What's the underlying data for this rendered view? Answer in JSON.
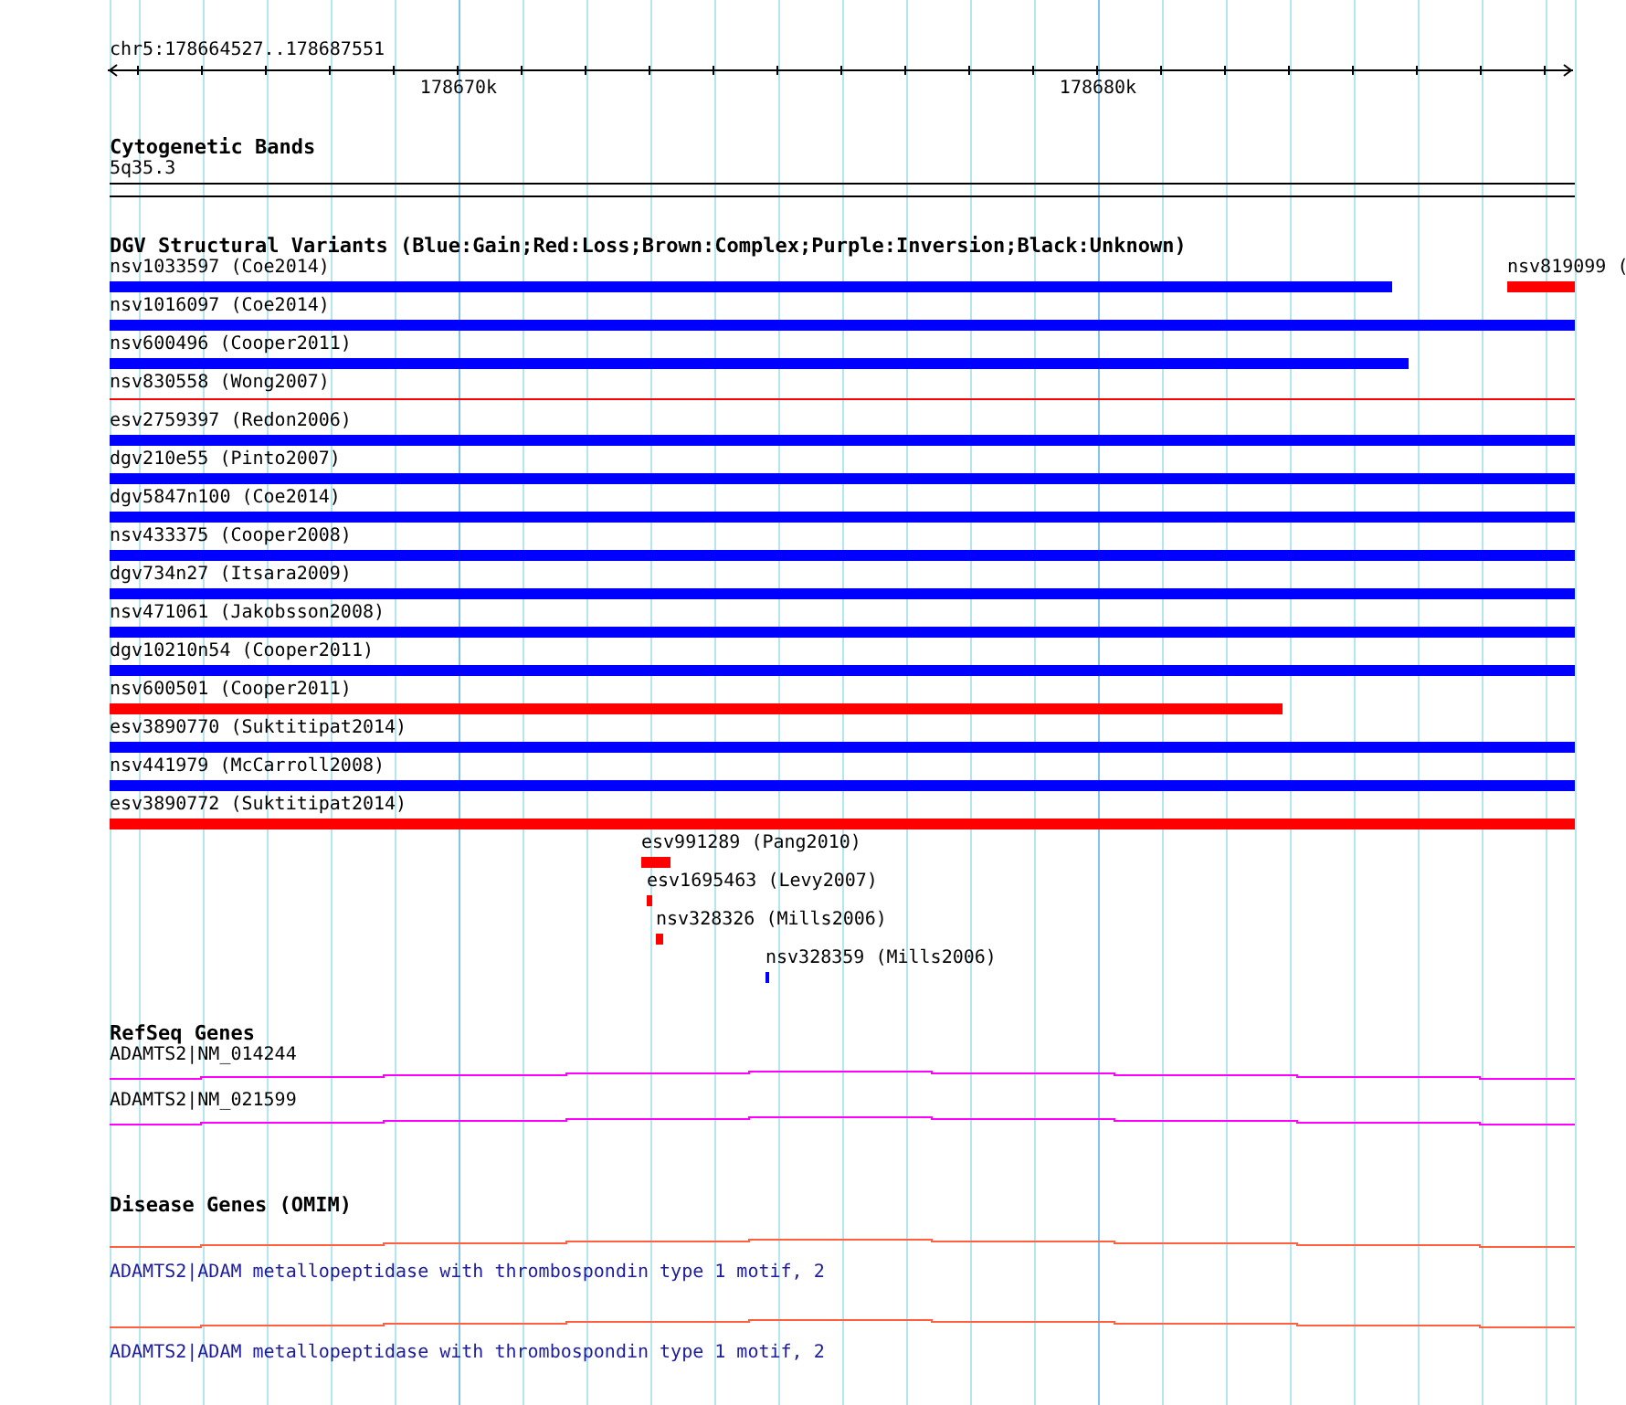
{
  "ruler": {
    "region": "chr5:178664527..178687551",
    "ticks": [
      "178670k",
      "178680k"
    ]
  },
  "cytogenetic_bands": {
    "title": "Cytogenetic Bands",
    "bands": [
      {
        "label": "5q35.3"
      }
    ]
  },
  "dgv_structural_variants": {
    "title": "DGV Structural Variants (Blue:Gain;Red:Loss;Brown:Complex;Purple:Inversion;Black:Unknown)",
    "rows": [
      {
        "features": [
          {
            "label": "nsv1033597 (Coe2014)",
            "color": "#0000ff",
            "kind": "bar"
          },
          {
            "label": "nsv819099 (",
            "color": "#ff0000",
            "kind": "bar"
          }
        ]
      },
      {
        "features": [
          {
            "label": "nsv1016097 (Coe2014)",
            "color": "#0000ff",
            "kind": "bar"
          }
        ]
      },
      {
        "features": [
          {
            "label": "nsv600496 (Cooper2011)",
            "color": "#0000ff",
            "kind": "bar"
          }
        ]
      },
      {
        "features": [
          {
            "label": "nsv830558 (Wong2007)",
            "color": "#ff0000",
            "kind": "line"
          }
        ]
      },
      {
        "features": [
          {
            "label": "esv2759397 (Redon2006)",
            "color": "#0000ff",
            "kind": "bar"
          }
        ]
      },
      {
        "features": [
          {
            "label": "dgv210e55 (Pinto2007)",
            "color": "#0000ff",
            "kind": "bar"
          }
        ]
      },
      {
        "features": [
          {
            "label": "dgv5847n100 (Coe2014)",
            "color": "#0000ff",
            "kind": "bar"
          }
        ]
      },
      {
        "features": [
          {
            "label": "nsv433375 (Cooper2008)",
            "color": "#0000ff",
            "kind": "bar"
          }
        ]
      },
      {
        "features": [
          {
            "label": "dgv734n27 (Itsara2009)",
            "color": "#0000ff",
            "kind": "bar"
          }
        ]
      },
      {
        "features": [
          {
            "label": "nsv471061 (Jakobsson2008)",
            "color": "#0000ff",
            "kind": "bar"
          }
        ]
      },
      {
        "features": [
          {
            "label": "dgv10210n54 (Cooper2011)",
            "color": "#0000ff",
            "kind": "bar"
          }
        ]
      },
      {
        "features": [
          {
            "label": "nsv600501 (Cooper2011)",
            "color": "#ff0000",
            "kind": "bar"
          }
        ]
      },
      {
        "features": [
          {
            "label": "esv3890770 (Suktitipat2014)",
            "color": "#0000ff",
            "kind": "bar"
          }
        ]
      },
      {
        "features": [
          {
            "label": "nsv441979 (McCarroll2008)",
            "color": "#0000ff",
            "kind": "bar"
          }
        ]
      },
      {
        "features": [
          {
            "label": "esv3890772 (Suktitipat2014)",
            "color": "#ff0000",
            "kind": "bar"
          }
        ]
      },
      {
        "features": [
          {
            "label": "esv991289 (Pang2010)",
            "color": "#ff0000",
            "kind": "bar"
          }
        ]
      },
      {
        "features": [
          {
            "label": "esv1695463 (Levy2007)",
            "color": "#ff0000",
            "kind": "bar"
          }
        ]
      },
      {
        "features": [
          {
            "label": "nsv328326 (Mills2006)",
            "color": "#ff0000",
            "kind": "bar"
          }
        ]
      },
      {
        "features": [
          {
            "label": "nsv328359 (Mills2006)",
            "color": "#0000ff",
            "kind": "bar"
          }
        ]
      }
    ]
  },
  "refseq_genes": {
    "title": "RefSeq Genes",
    "genes": [
      {
        "label": "ADAMTS2|NM_014244"
      },
      {
        "label": "ADAMTS2|NM_021599"
      }
    ]
  },
  "disease_genes": {
    "title": "Disease Genes (OMIM)",
    "genes": [
      {
        "label": "ADAMTS2|ADAM metallopeptidase with thrombospondin type 1 motif, 2"
      },
      {
        "label": "ADAMTS2|ADAM metallopeptidase with thrombospondin type 1 motif, 2"
      }
    ]
  }
}
